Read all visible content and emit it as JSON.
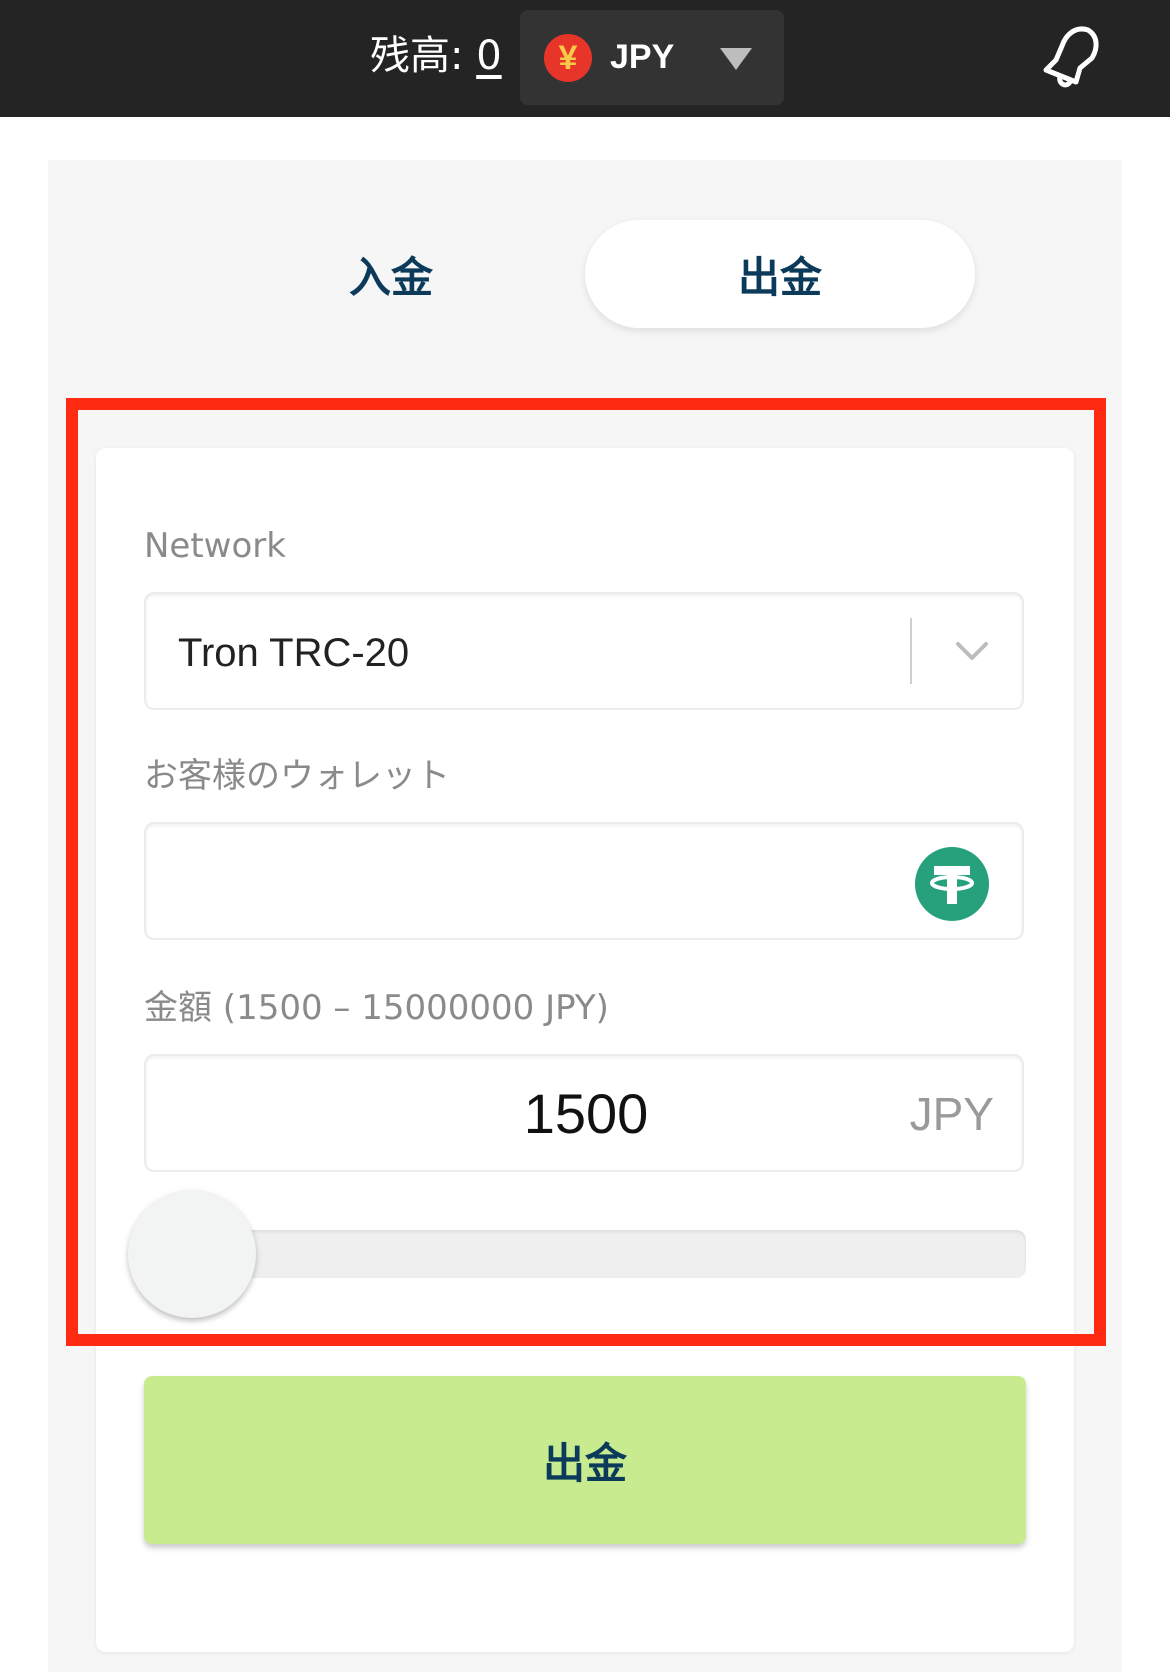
{
  "header": {
    "balance_label": "残高:",
    "balance_value": "0",
    "currency": "JPY",
    "currency_icon_glyph": "¥",
    "currency_icon": "yen-coin-icon",
    "notification_icon": "bell-icon"
  },
  "tabs": [
    {
      "label": "入金",
      "active": false
    },
    {
      "label": "出金",
      "active": true
    }
  ],
  "form": {
    "network_label": "Network",
    "network_value": "Tron TRC-20",
    "wallet_label": "お客様のウォレット",
    "wallet_value": "",
    "wallet_icon": "tether-icon",
    "amount_label": "金額 (1500 – 15000000 JPY)",
    "amount_value": "1500",
    "amount_unit": "JPY",
    "slider_level": 0
  },
  "submit_label": "出金",
  "colors": {
    "topbar": "#242424",
    "accent_green": "#c8eb8f",
    "tab_text": "#0b3a5a",
    "highlight": "#ff2a12",
    "tether": "#26a17b"
  }
}
